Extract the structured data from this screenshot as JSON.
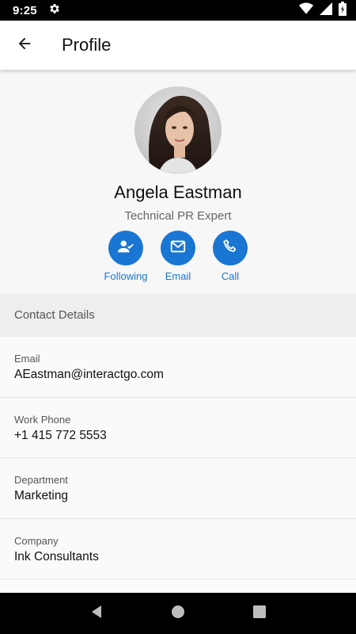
{
  "status_bar": {
    "time": "9:25",
    "icons": [
      "settings-icon",
      "wifi-icon",
      "signal-icon",
      "battery-icon"
    ]
  },
  "app_bar": {
    "back_icon": "arrow-left-icon",
    "title": "Profile"
  },
  "profile": {
    "name": "Angela Eastman",
    "role": "Technical PR Expert",
    "actions": [
      {
        "label": "Following",
        "icon": "person-check-icon"
      },
      {
        "label": "Email",
        "icon": "envelope-icon"
      },
      {
        "label": "Call",
        "icon": "phone-icon"
      }
    ]
  },
  "contact": {
    "section_title": "Contact Details",
    "fields": [
      {
        "label": "Email",
        "value": "AEastman@interactgo.com"
      },
      {
        "label": "Work Phone",
        "value": "+1 415 772 5553"
      },
      {
        "label": "Department",
        "value": "Marketing"
      },
      {
        "label": "Company",
        "value": "Ink Consultants"
      }
    ]
  },
  "nav": {
    "buttons": [
      "back-triangle-icon",
      "home-circle-icon",
      "recents-square-icon"
    ]
  },
  "colors": {
    "accent": "#1976d2",
    "status_bar": "#000000",
    "section_bg": "#eeeeee"
  }
}
